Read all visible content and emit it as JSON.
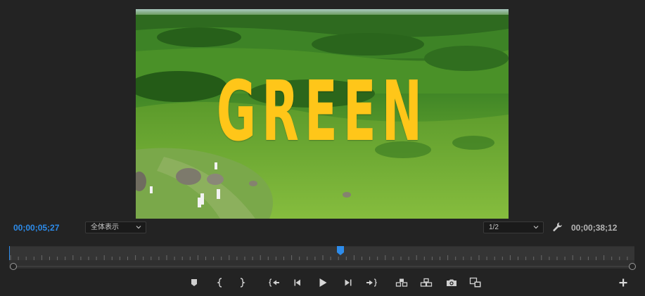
{
  "video": {
    "title_text": "GREEN",
    "title_color": "#ffc619"
  },
  "controls": {
    "current_timecode": "00;00;05;27",
    "fit_label": "全体表示",
    "resolution_label": "1/2",
    "duration_timecode": "00;00;38;12",
    "settings_icon": "wrench-icon"
  },
  "timeline": {
    "playhead_fraction": 0.53,
    "playhead_color": "#2d8ceb"
  },
  "transport": {
    "buttons": [
      {
        "name": "add-marker-button",
        "icon": "marker-icon"
      },
      {
        "name": "mark-in-button",
        "icon": "mark-in-icon"
      },
      {
        "name": "mark-out-button",
        "icon": "mark-out-icon"
      },
      {
        "name": "go-to-in-button",
        "icon": "go-to-in-icon"
      },
      {
        "name": "step-back-button",
        "icon": "step-back-icon"
      },
      {
        "name": "play-button",
        "icon": "play-icon"
      },
      {
        "name": "step-forward-button",
        "icon": "step-forward-icon"
      },
      {
        "name": "go-to-out-button",
        "icon": "go-to-out-icon"
      },
      {
        "name": "lift-button",
        "icon": "lift-icon"
      },
      {
        "name": "extract-button",
        "icon": "extract-icon"
      },
      {
        "name": "export-frame-button",
        "icon": "camera-icon"
      },
      {
        "name": "comparison-view-button",
        "icon": "comparison-view-icon"
      },
      {
        "name": "button-editor-button",
        "icon": "plus-icon"
      }
    ]
  }
}
